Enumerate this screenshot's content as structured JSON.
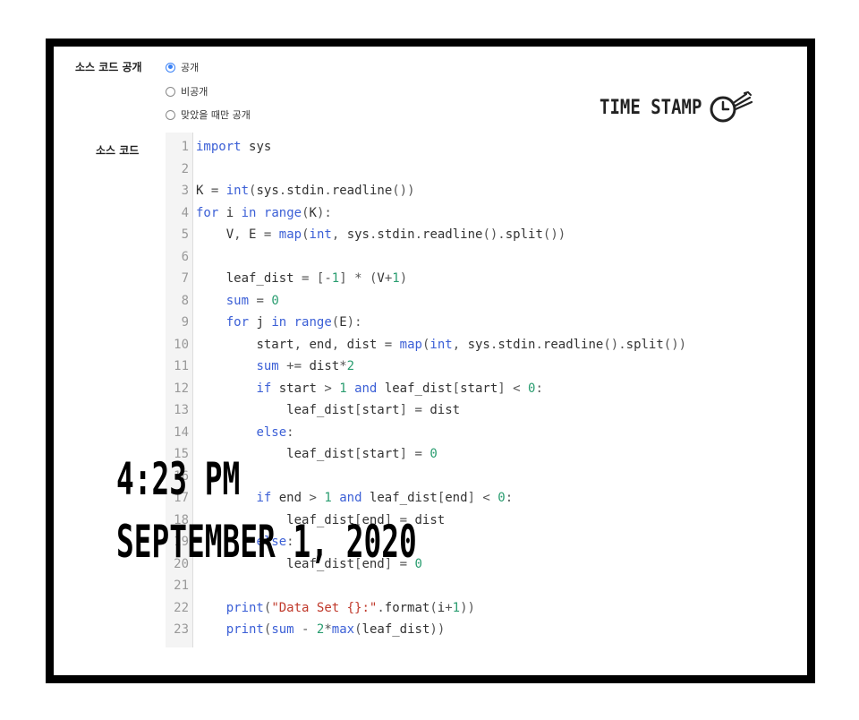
{
  "form": {
    "visibility_label": "소스 코드 공개",
    "visibility_options": [
      {
        "label": "공개",
        "checked": true
      },
      {
        "label": "비공개",
        "checked": false
      },
      {
        "label": "맞았을 때만 공개",
        "checked": false
      }
    ],
    "source_label": "소스 코드"
  },
  "logo": {
    "text": "TIME STAMP",
    "icon": "clock-stamp-icon"
  },
  "code": {
    "lines": [
      {
        "n": "1",
        "text": "import sys"
      },
      {
        "n": "2",
        "text": ""
      },
      {
        "n": "3",
        "text": "K = int(sys.stdin.readline())"
      },
      {
        "n": "4",
        "text": "for i in range(K):"
      },
      {
        "n": "5",
        "text": "    V, E = map(int, sys.stdin.readline().split())"
      },
      {
        "n": "6",
        "text": ""
      },
      {
        "n": "7",
        "text": "    leaf_dist = [-1] * (V+1)"
      },
      {
        "n": "8",
        "text": "    sum = 0"
      },
      {
        "n": "9",
        "text": "    for j in range(E):"
      },
      {
        "n": "10",
        "text": "        start, end, dist = map(int, sys.stdin.readline().split())"
      },
      {
        "n": "11",
        "text": "        sum += dist*2"
      },
      {
        "n": "12",
        "text": "        if start > 1 and leaf_dist[start] < 0:"
      },
      {
        "n": "13",
        "text": "            leaf_dist[start] = dist"
      },
      {
        "n": "14",
        "text": "        else:"
      },
      {
        "n": "15",
        "text": "            leaf_dist[start] = 0"
      },
      {
        "n": "16",
        "text": ""
      },
      {
        "n": "17",
        "text": "        if end > 1 and leaf_dist[end] < 0:"
      },
      {
        "n": "18",
        "text": "            leaf_dist[end] = dist"
      },
      {
        "n": "19",
        "text": "        else:"
      },
      {
        "n": "20",
        "text": "            leaf_dist[end] = 0"
      },
      {
        "n": "21",
        "text": ""
      },
      {
        "n": "22",
        "text": "    print(\"Data Set {}:\".format(i+1))"
      },
      {
        "n": "23",
        "text": "    print(sum - 2*max(leaf_dist))"
      }
    ]
  },
  "overlay": {
    "time": "4:23 PM",
    "date": "SEPTEMBER 1, 2020"
  },
  "colors": {
    "keyword": "#3b5fd6",
    "number": "#2a9d70",
    "string": "#c0392b",
    "radio_checked": "#3b82f6"
  }
}
